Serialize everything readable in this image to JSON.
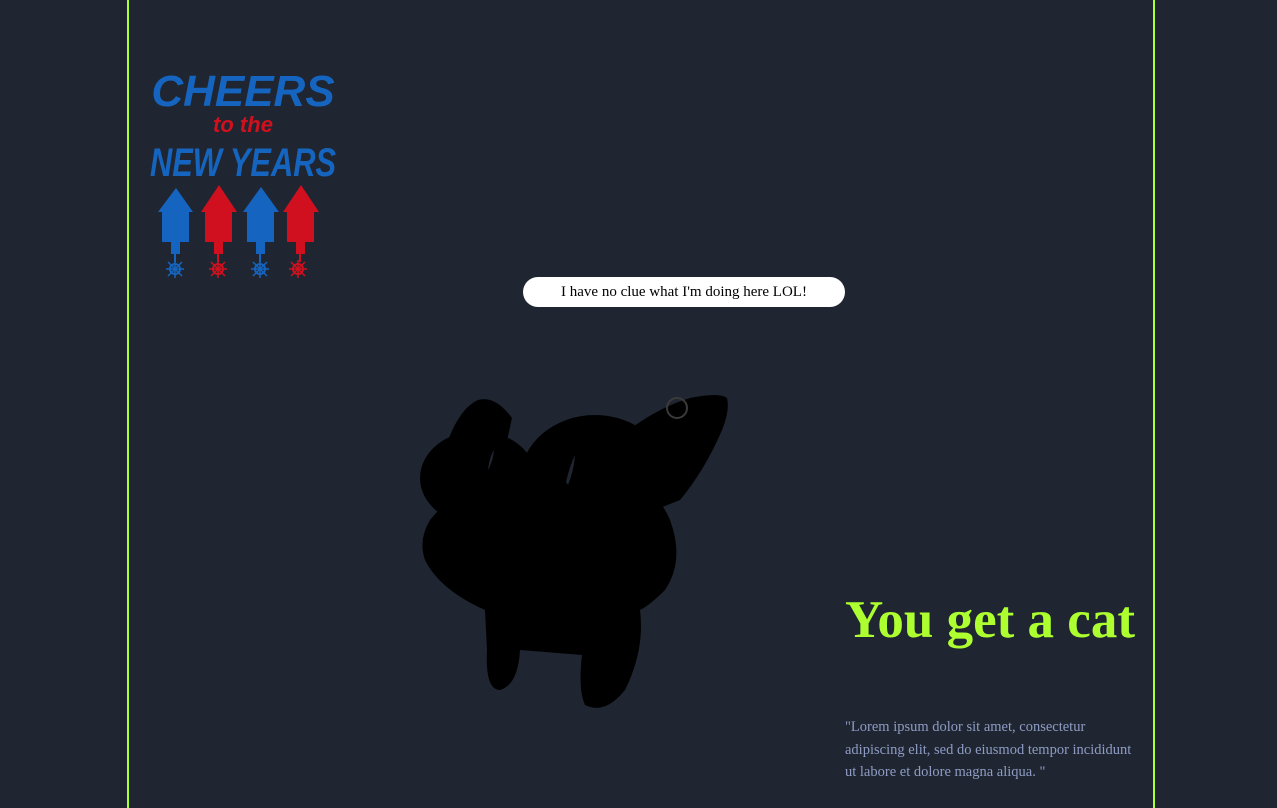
{
  "logo": {
    "line1": "CHEERS",
    "line2": "to the",
    "line3": "NEW YEARS"
  },
  "speech_bubble": {
    "text": "I have no clue what I'm doing here LOL!"
  },
  "hero": {
    "title": "You get a cat",
    "quote": "\"Lorem ipsum dolor sit amet, consectetur adipiscing elit, sed do eiusmod tempor incididunt ut labore et dolore magna aliqua. \""
  },
  "colors": {
    "background": "#1f2631",
    "accent": "#adff2f",
    "logo_blue": "#1565c0",
    "logo_red": "#d0101e",
    "quote_text": "#8e9cc4"
  }
}
